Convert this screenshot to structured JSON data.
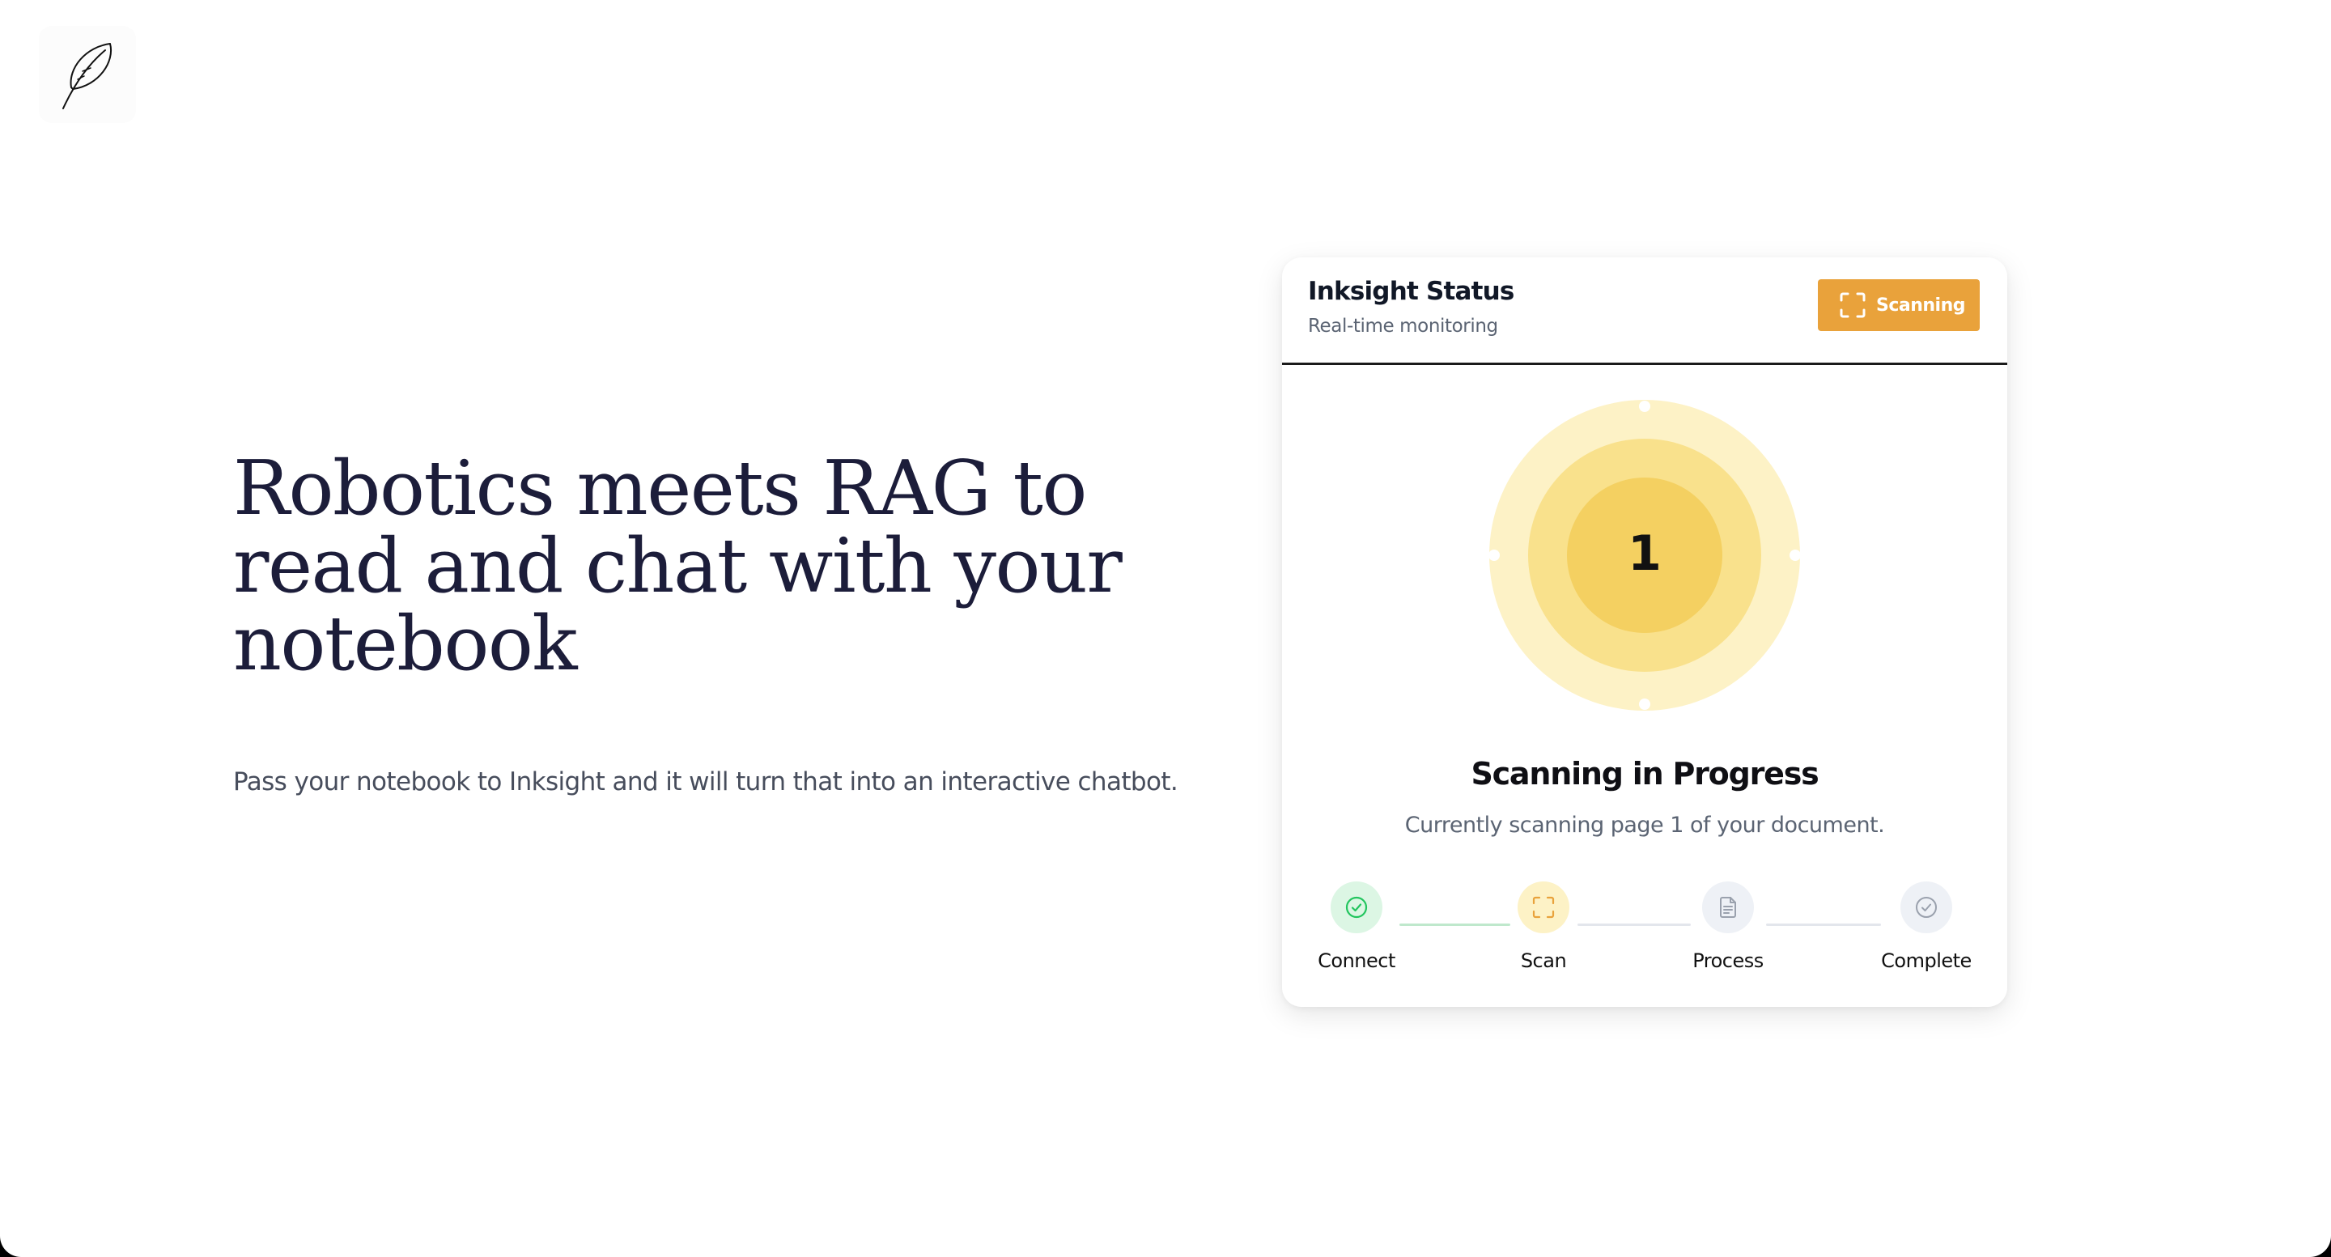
{
  "hero": {
    "title": "Robotics meets RAG to read and chat with your notebook",
    "subtitle": "Pass your notebook to Inksight and it will turn that into an interactive chatbot."
  },
  "status_card": {
    "title": "Inksight Status",
    "subtitle": "Real-time monitoring",
    "status_button": "Scanning",
    "current_page": "1",
    "progress_title": "Scanning in Progress",
    "progress_description": "Currently scanning page 1 of your document."
  },
  "steps": [
    {
      "label": "Connect",
      "state": "completed",
      "icon": "check-circle-icon"
    },
    {
      "label": "Scan",
      "state": "active",
      "icon": "scan-frame-icon"
    },
    {
      "label": "Process",
      "state": "pending",
      "icon": "document-icon"
    },
    {
      "label": "Complete",
      "state": "pending",
      "icon": "check-circle-icon"
    }
  ],
  "colors": {
    "accent": "#e9a23b",
    "completed": "#22c55e",
    "active_bg": "#fdf2c6",
    "pending_bg": "#eef1f6",
    "heading": "#1c1d3a"
  }
}
